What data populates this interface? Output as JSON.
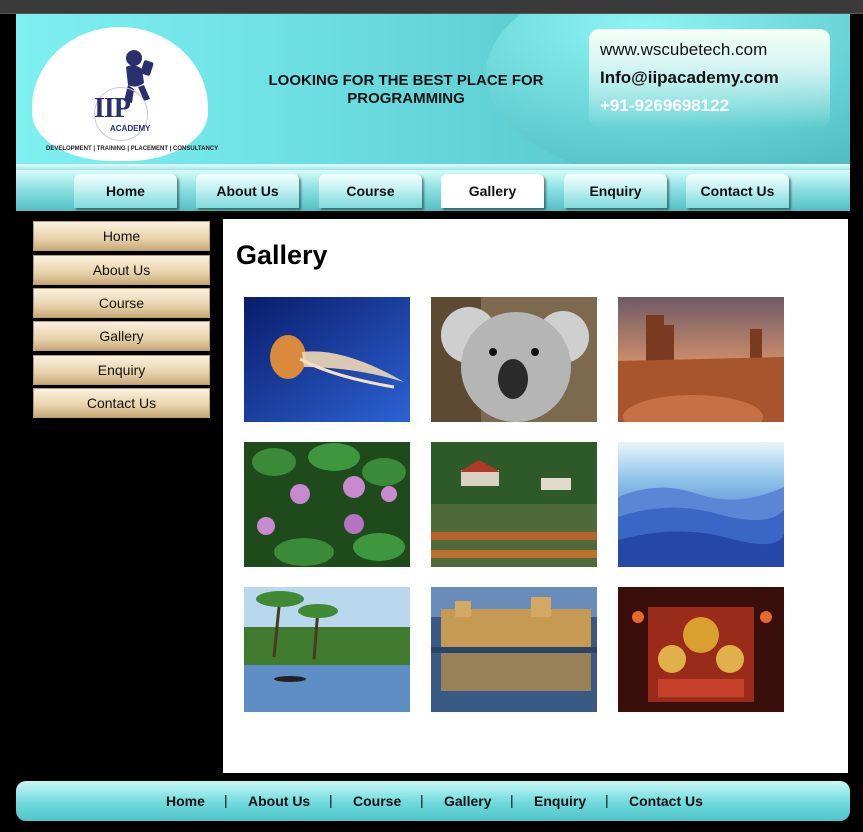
{
  "header": {
    "logo_text": "IIP",
    "logo_sub": "ACADEMY",
    "logo_tagline": "DEVELOPMENT | TRAINING | PLACEMENT | CONSULTANCY",
    "tagline": "LOOKING FOR THE BEST PLACE FOR PROGRAMMING",
    "website": "www.wscubetech.com",
    "email": "Info@iipacademy.com",
    "phone": "+91-9269698122"
  },
  "nav": {
    "items": [
      "Home",
      "About Us",
      "Course",
      "Gallery",
      "Enquiry",
      "Contact Us"
    ],
    "active": "Gallery"
  },
  "sidebar": {
    "items": [
      "Home",
      "About Us",
      "Course",
      "Gallery",
      "Enquiry",
      "Contact Us"
    ]
  },
  "content": {
    "title": "Gallery",
    "images": [
      "jellyfish",
      "koala",
      "desert",
      "water-lilies",
      "lake-boats",
      "blue-mountains",
      "backwaters",
      "palace-reflection",
      "shrine"
    ]
  },
  "footer": {
    "items": [
      "Home",
      "About Us",
      "Course",
      "Gallery",
      "Enquiry",
      "Contact Us"
    ],
    "separator": "|"
  },
  "colors": {
    "header_teal": "#5fd0d4",
    "nav_active": "#ffffff",
    "sidebar_tan": "#e8d2ab"
  }
}
